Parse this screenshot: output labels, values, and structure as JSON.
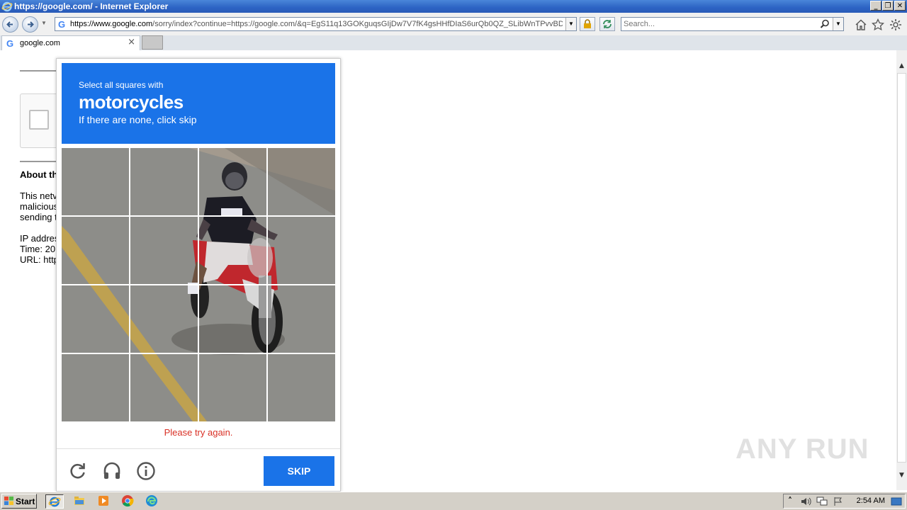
{
  "window": {
    "title": "https://google.com/ - Internet Explorer",
    "buttons": {
      "minimize": "_",
      "restore": "❐",
      "close": "✕"
    }
  },
  "toolbar": {
    "address_host": "https://www.google.com",
    "address_path": "/sorry/index?continue=https://google.com/&q=EgS11q13GOKguqsGIjDw7V7fK4gsHHfDIaS6urQb0QZ_SLibWnTPvvBDwE",
    "search_placeholder": "Search...",
    "icons": [
      "back-icon",
      "forward-icon",
      "lock-icon",
      "refresh-icon",
      "search-icon",
      "home-icon",
      "favorites-icon",
      "settings-icon"
    ]
  },
  "tab": {
    "label": "google.com",
    "close": "×"
  },
  "page": {
    "heading": "About th",
    "body_lines": [
      "This netv",
      "malicious",
      "sending t"
    ],
    "ip_line": "IP addres",
    "time_line": "Time: 20",
    "url_line": "URL: http"
  },
  "challenge": {
    "instruction": "Select all squares with",
    "target": "motorcycles",
    "hint": "If there are none, click skip",
    "error": "Please try again.",
    "skip_label": "SKIP",
    "accent_color": "#1a73e8",
    "error_color": "#d93025",
    "grid_size": "4x4",
    "footer_icons": [
      "reload-icon",
      "audio-icon",
      "info-icon"
    ]
  },
  "watermark": "ANY RUN",
  "taskbar": {
    "start_label": "Start",
    "apps": [
      "internet-explorer-icon",
      "file-explorer-icon",
      "media-player-icon",
      "chrome-icon",
      "edge-icon"
    ],
    "tray_expand": "˄",
    "clock": "2:54 AM"
  }
}
